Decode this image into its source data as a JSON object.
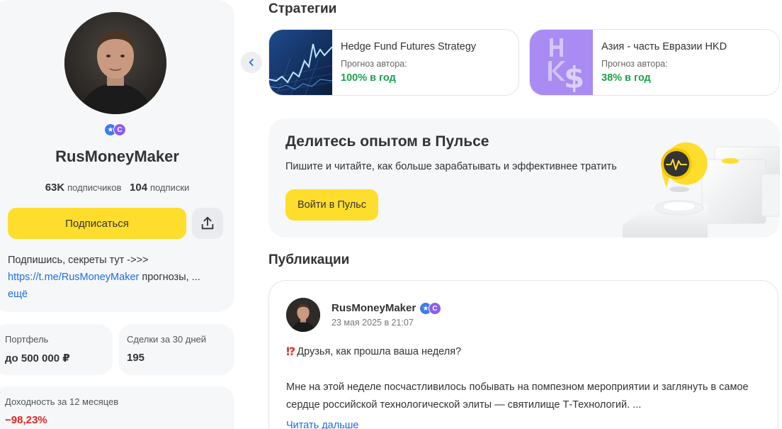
{
  "profile": {
    "username": "RusMoneyMaker",
    "followers_count": "63K",
    "followers_label": "подписчиков",
    "following_count": "104",
    "following_label": "подписки",
    "subscribe_label": "Подписаться",
    "bio_text": "Подпишись, секреты тут ->>>",
    "bio_link": "https://t.me/RusMoneyMaker",
    "bio_tail": " прогнозы, ...",
    "bio_more": "ещё"
  },
  "stats": {
    "portfolio_label": "Портфель",
    "portfolio_value": "до 500 000 ₽",
    "deals_label": "Сделки за 30 дней",
    "deals_value": "195",
    "return_label": "Доходность за 12 месяцев",
    "return_value": "−98,23%"
  },
  "strategies": {
    "title": "Стратегии",
    "items": [
      {
        "name": "Hedge Fund Futures Strategy",
        "sub": "Прогноз автора:",
        "yield": "100% в год"
      },
      {
        "name": "Азия - часть Евразии HKD",
        "sub": "Прогноз автора:",
        "yield": "38% в год"
      }
    ]
  },
  "pulse": {
    "title": "Делитесь опытом в Пульсе",
    "text": "Пишите и читайте, как больше зарабатывать и эффективнее тратить",
    "button": "Войти в Пульс"
  },
  "publications": {
    "title": "Публикации",
    "post": {
      "author": "RusMoneyMaker",
      "date": "23 мая 2025 в 21:07",
      "line1": "Друзья, как прошла ваша неделя?",
      "body": "Мне на этой неделе посчастливилось побывать на помпезном мероприятии и заглянуть в самое сердце российской технологической элиты — святилище Т-Технологий.  ...",
      "read_more": "Читать дальше"
    }
  },
  "colors": {
    "accent_yellow": "#ffdd2d",
    "link_blue": "#1e6fe0",
    "positive_green": "#1aa34a",
    "negative_red": "#e02525"
  }
}
